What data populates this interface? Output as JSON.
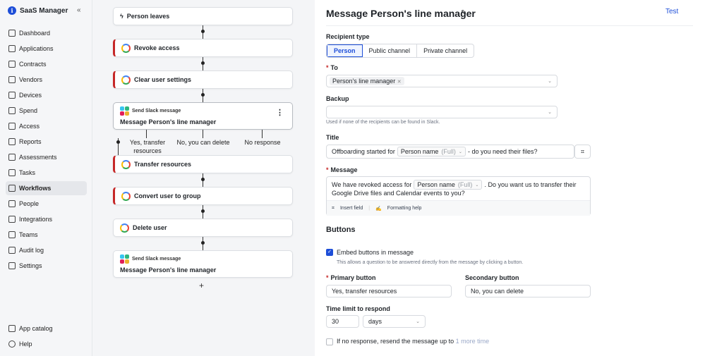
{
  "app": {
    "name": "SaaS Manager"
  },
  "sidebar": {
    "items": [
      {
        "label": "Dashboard"
      },
      {
        "label": "Applications"
      },
      {
        "label": "Contracts"
      },
      {
        "label": "Vendors"
      },
      {
        "label": "Devices"
      },
      {
        "label": "Spend"
      },
      {
        "label": "Access"
      },
      {
        "label": "Reports"
      },
      {
        "label": "Assessments"
      },
      {
        "label": "Tasks"
      },
      {
        "label": "Workflows"
      },
      {
        "label": "People"
      },
      {
        "label": "Integrations"
      },
      {
        "label": "Teams"
      },
      {
        "label": "Audit log"
      },
      {
        "label": "Settings"
      }
    ],
    "bottom": [
      {
        "label": "App catalog"
      },
      {
        "label": "Help"
      }
    ]
  },
  "workflow": {
    "trigger": "Person leaves",
    "steps": [
      {
        "title": "Revoke access"
      },
      {
        "title": "Clear user settings"
      },
      {
        "sub": "Send Slack message",
        "title": "Message Person's line manager"
      },
      {
        "title": "Transfer resources"
      },
      {
        "title": "Convert user to group"
      },
      {
        "title": "Delete user"
      },
      {
        "sub": "Send Slack message",
        "title": "Message Person's line manager"
      }
    ],
    "branches": [
      "Yes, transfer resources",
      "No, you can delete",
      "No response"
    ]
  },
  "panel": {
    "title": "Message Person's line manager",
    "test": "Test",
    "recipient_type_label": "Recipient type",
    "recipient_types": [
      "Person",
      "Public channel",
      "Private channel"
    ],
    "to_label": "To",
    "to_value": "Person's line manager",
    "backup_label": "Backup",
    "backup_help": "Used if none of the recipients can be found in Slack.",
    "title_label": "Title",
    "title_prefix": "Offboarding started for",
    "title_chip": "Person name",
    "title_chip_full": "(Full)",
    "title_suffix": "- do you need their files?",
    "message_label": "Message",
    "message_prefix": "We have revoked access for",
    "message_chip": "Person name",
    "message_chip_full": "(Full)",
    "message_mid": ". Do you want us to transfer their",
    "message_line2": "Google Drive files and Calendar events to you?",
    "insert_field": "Insert field",
    "formatting_help": "Formatting help",
    "buttons_heading": "Buttons",
    "embed_label": "Embed buttons in message",
    "embed_help": "This allows a question to be answered directly from the message by clicking a button.",
    "primary_label": "Primary button",
    "primary_value": "Yes, transfer resources",
    "secondary_label": "Secondary button",
    "secondary_value": "No, you can delete",
    "time_label": "Time limit to respond",
    "time_value": "30",
    "time_unit": "days",
    "resend_prefix": "If no response, resend the message up to",
    "resend_link": "1 more time"
  }
}
